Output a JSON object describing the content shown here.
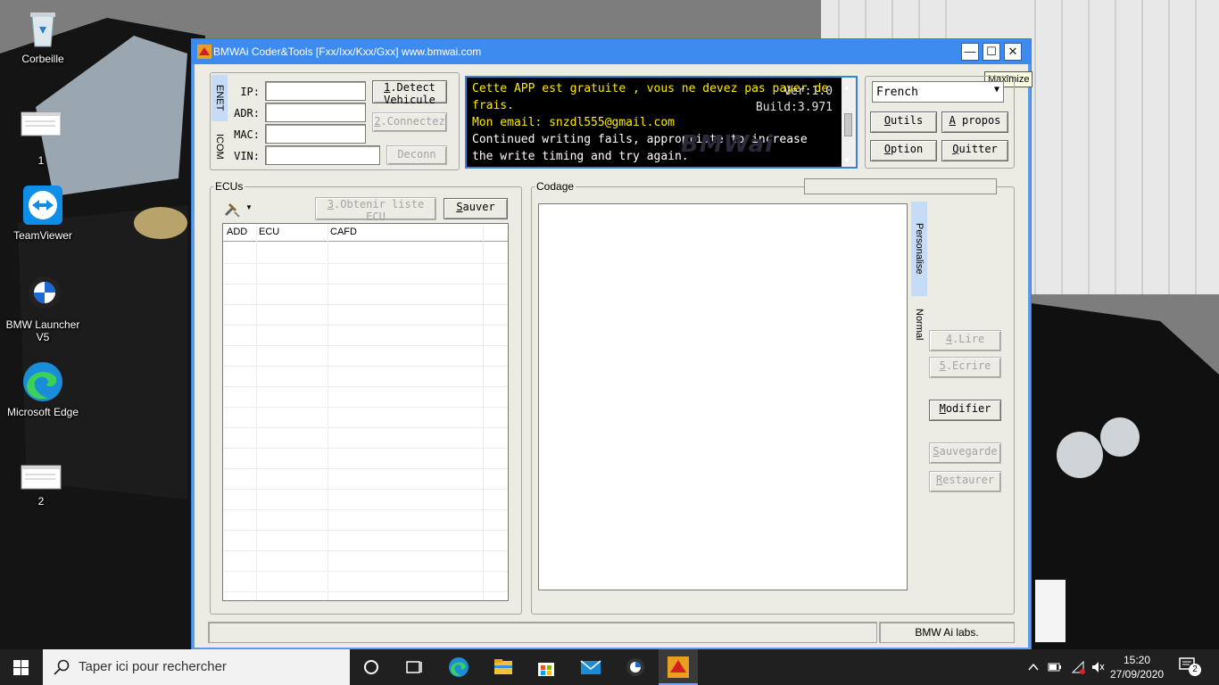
{
  "desktop": {
    "icons": [
      {
        "id": "recycle",
        "label": "Corbeille"
      },
      {
        "id": "file1",
        "label": "1"
      },
      {
        "id": "teamviewer",
        "label": "TeamViewer"
      },
      {
        "id": "bmwlauncher",
        "label": "BMW Launcher V5"
      },
      {
        "id": "edge",
        "label": "Microsoft Edge"
      },
      {
        "id": "file2",
        "label": "2"
      }
    ]
  },
  "window": {
    "title": "BMWAi Coder&Tools [Fxx/Ixx/Kxx/Gxx]  www.bmwai.com",
    "tooltip": "Maximize",
    "controls": {
      "minimize": "—",
      "maximize": "☐",
      "close": "✕"
    }
  },
  "connection": {
    "tabs": {
      "enet": "ENET",
      "icom": "ICOM"
    },
    "labels": {
      "ip": "IP:",
      "adr": "ADR:",
      "mac": "MAC:",
      "vin": "VIN:"
    },
    "values": {
      "ip": "",
      "adr": "",
      "mac": "",
      "vin": ""
    },
    "buttons": {
      "detect_key": "1",
      "detect_rest": ".Detect",
      "detect_line2": "Vehicule",
      "connect_key": "2",
      "connect_rest": ".Connectez",
      "disconnect": "Deconn"
    }
  },
  "console": {
    "line1": "Cette APP est gratuite , vous ne devez pas payer de",
    "line2": "frais.",
    "line3": "Mon email: snzdl555@gmail.com",
    "line4": "Continued writing fails, appropriate to increase",
    "line5": "the write timing and try again.",
    "version": "Ver:1.0",
    "build": "Build:3.971",
    "watermark": "BMWai"
  },
  "settings": {
    "language": "French",
    "buttons": {
      "outils_key": "O",
      "outils_rest": "utils",
      "apropos_key": "A",
      "apropos_rest": " propos",
      "option_key": "O",
      "option_rest": "ption",
      "quitter_key": "Q",
      "quitter_rest": "uitter"
    }
  },
  "ecus": {
    "label": "ECUs",
    "get_list_key": "3",
    "get_list_rest": ".Obtenir liste",
    "get_list_line2": "ECU",
    "save_key": "S",
    "save_rest": "auver",
    "columns": [
      "ADD",
      "ECU",
      "CAFD"
    ]
  },
  "codage": {
    "label": "Codage",
    "tabs": {
      "personalise": "Personalise",
      "normal": "Normal"
    },
    "buttons": {
      "lire_key": "4",
      "lire_rest": ".Lire",
      "ecrire_key": "5",
      "ecrire_rest": ".Ecrire",
      "modifier_key": "M",
      "modifier_rest": "odifier",
      "sauvegarde_key": "S",
      "sauvegarde_rest": "auvegarde",
      "restaurer_key": "R",
      "restaurer_rest": "estaurer"
    }
  },
  "statusbar": {
    "main": "",
    "right": "BMW Ai labs."
  },
  "taskbar": {
    "search_placeholder": "Taper ici pour rechercher",
    "time": "15:20",
    "date": "27/09/2020",
    "notifications": "2"
  },
  "colors": {
    "titlebar": "#3e8bf0",
    "console_bg": "#000000",
    "console_yellow": "#ffea00",
    "window_bg": "#ecebe4"
  }
}
